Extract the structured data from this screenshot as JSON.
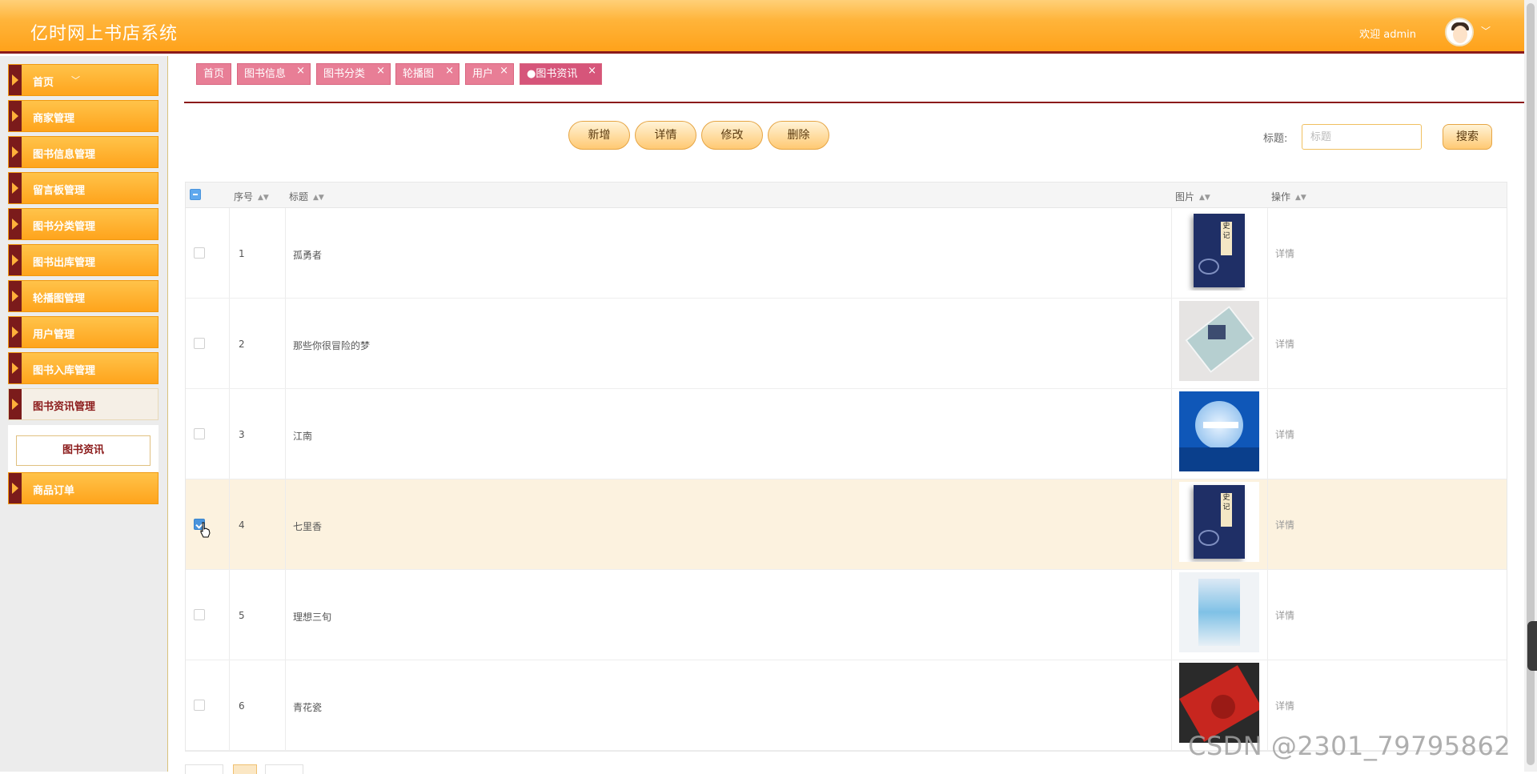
{
  "header": {
    "app_title": "亿时网上书店系统",
    "welcome": "欢迎 admin"
  },
  "sidebar": {
    "items": [
      {
        "label": "首页",
        "has_chevron": true
      },
      {
        "label": "商家管理"
      },
      {
        "label": "图书信息管理"
      },
      {
        "label": "留言板管理"
      },
      {
        "label": "图书分类管理"
      },
      {
        "label": "图书出库管理"
      },
      {
        "label": "轮播图管理"
      },
      {
        "label": "用户管理"
      },
      {
        "label": "图书入库管理"
      },
      {
        "label": "图书资讯管理",
        "active": true
      },
      {
        "label": "商品订单"
      }
    ],
    "submenu": {
      "label": "图书资讯"
    }
  },
  "tabs": [
    {
      "label": "首页",
      "closable": false
    },
    {
      "label": "图书信息",
      "closable": true
    },
    {
      "label": "图书分类",
      "closable": true
    },
    {
      "label": "轮播图",
      "closable": true
    },
    {
      "label": "用户",
      "closable": true
    },
    {
      "label": "●图书资讯",
      "closable": true,
      "active": true
    }
  ],
  "toolbar": {
    "add": "新增",
    "detail": "详情",
    "edit": "修改",
    "delete": "删除"
  },
  "search": {
    "label": "标题:",
    "placeholder": "标题",
    "button": "搜索"
  },
  "table": {
    "columns": [
      "序号",
      "标题",
      "图片",
      "操作"
    ],
    "rows": [
      {
        "index": "1",
        "title": "孤勇者",
        "image": "book-cover-navy",
        "action": "详情",
        "checked": false
      },
      {
        "index": "2",
        "title": "那些你很冒险的梦",
        "image": "book-cover-pale",
        "action": "详情",
        "checked": false
      },
      {
        "index": "3",
        "title": "江南",
        "image": "book-cover-moon",
        "action": "详情",
        "checked": false
      },
      {
        "index": "4",
        "title": "七里香",
        "image": "book-cover-navy",
        "action": "详情",
        "checked": true,
        "highlighted": true
      },
      {
        "index": "5",
        "title": "理想三旬",
        "image": "book-cover-ice",
        "action": "详情",
        "checked": false
      },
      {
        "index": "6",
        "title": "青花瓷",
        "image": "book-cover-red",
        "action": "详情",
        "checked": false
      }
    ]
  },
  "book_label": "史记",
  "watermark": "CSDN @2301_79795862",
  "colors": {
    "header_orange": "#ffa21a",
    "accent_maroon": "#8b1a1a",
    "tab_pink": "#e87e96",
    "row_highlight": "#fcf2df"
  }
}
